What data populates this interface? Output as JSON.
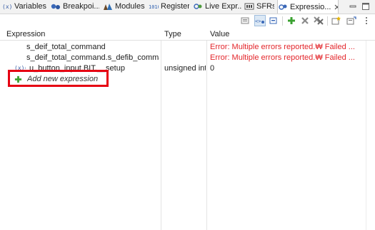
{
  "tabs": [
    {
      "label": "Variables",
      "icon": "variables-icon",
      "active": false
    },
    {
      "label": "Breakpoi...",
      "icon": "breakpoints-icon",
      "active": false
    },
    {
      "label": "Modules",
      "icon": "modules-icon",
      "active": false
    },
    {
      "label": "Registers",
      "icon": "registers-icon",
      "active": false
    },
    {
      "label": "Live Expr...",
      "icon": "live-expressions-icon",
      "active": false
    },
    {
      "label": "SFRs",
      "icon": "sfrs-icon",
      "active": false
    },
    {
      "label": "Expressio...",
      "icon": "expressions-icon",
      "active": true
    }
  ],
  "table": {
    "columns": [
      "Expression",
      "Type",
      "Value"
    ],
    "rows": [
      {
        "prefix": "",
        "expression": "s_deif_total_command",
        "type": "",
        "value": "Error: Multiple errors reported.₩ Failed ...",
        "error": true
      },
      {
        "prefix": "",
        "expression": "s_deif_total_command.s_defib_command_",
        "type": "",
        "value": "Error: Multiple errors reported.₩ Failed ...",
        "error": true
      },
      {
        "prefix": "(x)=",
        "expression": "u_button_input.BIT.__setup",
        "type": "unsigned int",
        "value": "0",
        "error": false
      }
    ],
    "add_label": "Add new expression"
  },
  "colors": {
    "error": "#e3262b",
    "highlight": "#e60012",
    "add_green": "#3aa130"
  }
}
